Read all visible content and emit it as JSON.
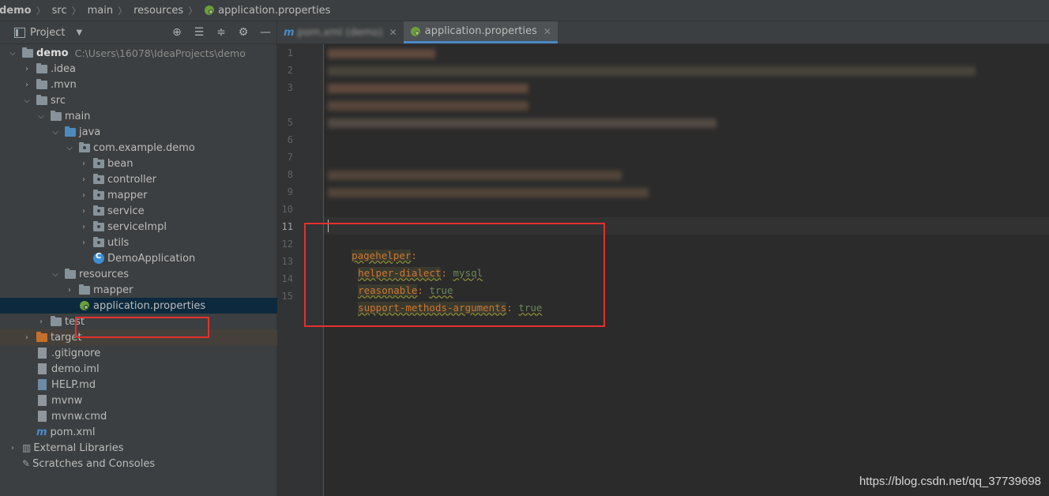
{
  "breadcrumb": [
    "demo",
    "src",
    "main",
    "resources",
    "application.properties"
  ],
  "project_panel": {
    "title": "Project",
    "tools": [
      "locate-icon",
      "expand-all-icon",
      "collapse-all-icon",
      "gear-icon",
      "minimize-icon"
    ]
  },
  "tree": {
    "root": {
      "label": "demo",
      "path": "C:\\Users\\16078\\IdeaProjects\\demo"
    },
    "items": [
      {
        "label": ".idea"
      },
      {
        "label": ".mvn"
      },
      {
        "label": "src"
      },
      {
        "label": "main"
      },
      {
        "label": "java"
      },
      {
        "label": "com.example.demo"
      },
      {
        "label": "bean"
      },
      {
        "label": "controller"
      },
      {
        "label": "mapper"
      },
      {
        "label": "service"
      },
      {
        "label": "serviceImpl"
      },
      {
        "label": "utils"
      },
      {
        "label": "DemoApplication"
      },
      {
        "label": "resources"
      },
      {
        "label": "mapper"
      },
      {
        "label": "application.properties"
      },
      {
        "label": "test"
      },
      {
        "label": "target"
      },
      {
        "label": ".gitignore"
      },
      {
        "label": "demo.iml"
      },
      {
        "label": "HELP.md"
      },
      {
        "label": "mvnw"
      },
      {
        "label": "mvnw.cmd"
      },
      {
        "label": "pom.xml"
      },
      {
        "label": "External Libraries"
      },
      {
        "label": "Scratches and Consoles"
      }
    ]
  },
  "tabs": [
    {
      "label": "pom.xml (demo)",
      "active": false
    },
    {
      "label": "application.properties",
      "active": true
    }
  ],
  "editor": {
    "line_numbers": [
      "1",
      "2",
      "3",
      "5",
      "6",
      "7",
      "8",
      "9",
      "10",
      "11",
      "12",
      "13",
      "14",
      "15"
    ],
    "current_line": "11",
    "code": {
      "l12_key": "pagehelper",
      "l13_key": "helper-dialect",
      "l13_val": "mysql",
      "l14_key": "reasonable",
      "l14_val": "true",
      "l15_key": "support-methods-arguments",
      "l15_val": "true"
    }
  },
  "watermark": "https://blog.csdn.net/qq_37739698",
  "colors": {
    "highlight_box": "#e3312d",
    "selection": "#0d293e",
    "yaml_key": "#cc7832",
    "yaml_value": "#6a8759"
  }
}
